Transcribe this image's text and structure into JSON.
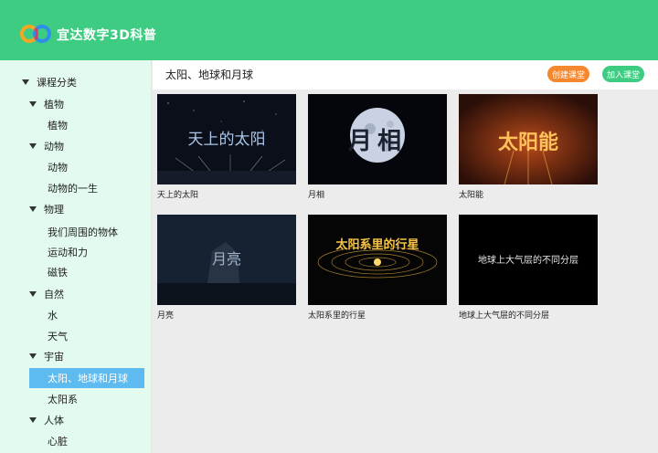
{
  "app": {
    "brand": "宜达数字3D科普"
  },
  "header": {
    "title": "太阳、地球和月球",
    "create_label": "创建课堂",
    "join_label": "加入课堂"
  },
  "sidebar": {
    "root": "课程分类",
    "groups": [
      {
        "label": "植物",
        "items": [
          "植物"
        ]
      },
      {
        "label": "动物",
        "items": [
          "动物",
          "动物的一生"
        ]
      },
      {
        "label": "物理",
        "items": [
          "我们周围的物体",
          "运动和力",
          "磁铁"
        ]
      },
      {
        "label": "自然",
        "items": [
          "水",
          "天气"
        ]
      },
      {
        "label": "宇宙",
        "items": [
          "太阳、地球和月球",
          "太阳系"
        ]
      },
      {
        "label": "人体",
        "items": [
          "心脏"
        ]
      }
    ],
    "selected": "太阳、地球和月球"
  },
  "cards": [
    {
      "label": "天上的太阳",
      "overlay": "天上的太阳"
    },
    {
      "label": "月相",
      "overlay": "月相"
    },
    {
      "label": "太阳能",
      "overlay": "太阳能"
    },
    {
      "label": "月亮",
      "overlay": "月亮"
    },
    {
      "label": "太阳系里的行星",
      "overlay": "太阳系里的行星"
    },
    {
      "label": "地球上大气层的不同分层",
      "overlay": "地球上大气层的不同分层"
    }
  ],
  "colors": {
    "topbar": "#3ecc83",
    "create": "#f5872e",
    "join": "#3ecc83",
    "selected": "#5dbbf0",
    "sidebar": "#e3fbef"
  },
  "icons": {
    "logo": "brand-logo-icon",
    "expand": "caret-down-icon"
  }
}
